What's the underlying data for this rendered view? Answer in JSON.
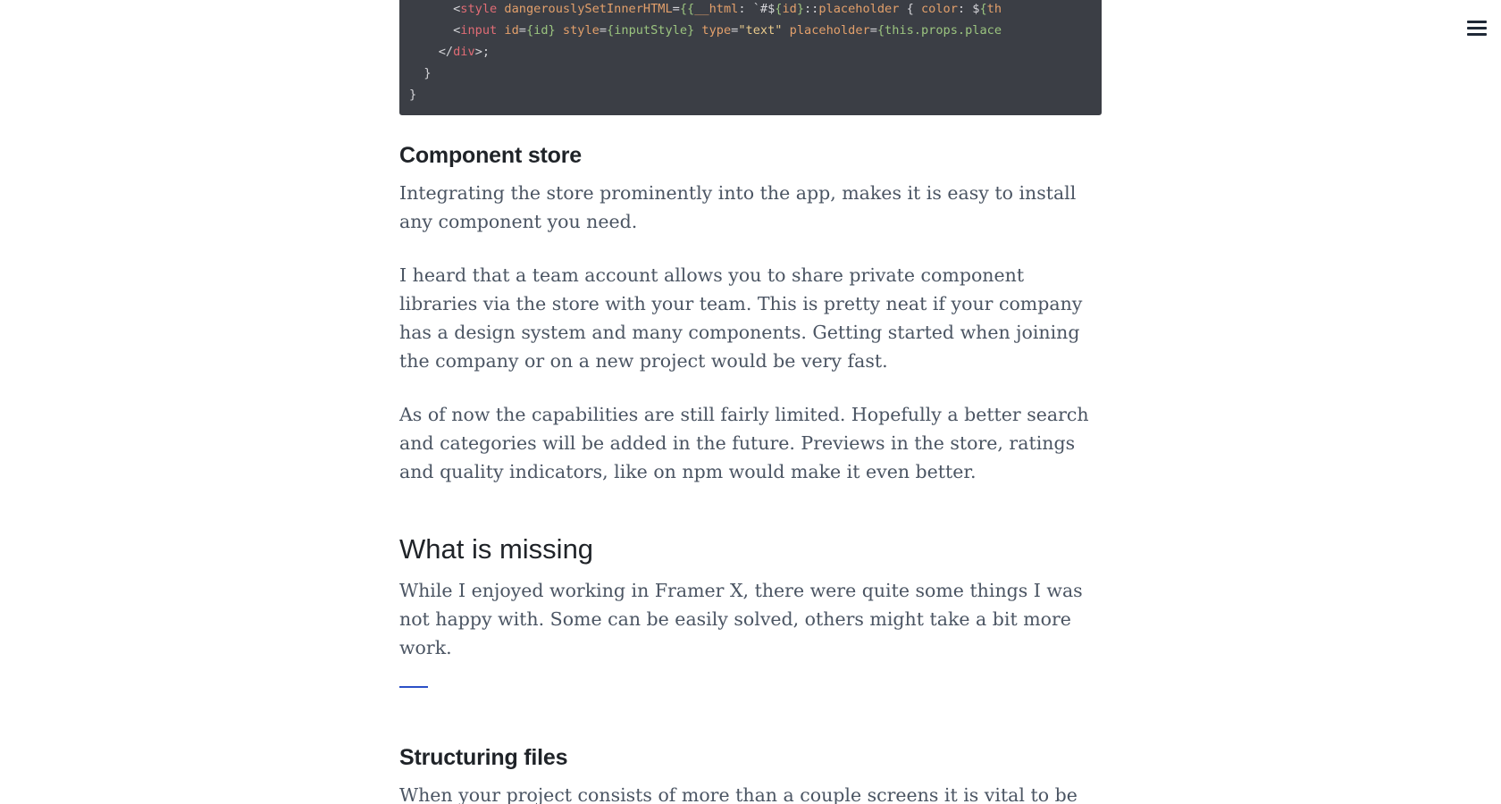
{
  "header": {
    "menu_icon": "hamburger-menu-icon"
  },
  "code": {
    "lines": [
      "      <style dangerouslySetInnerHTML={{__html: `#${id}::placeholder { color: ${th",
      "      <input id={id} style={inputStyle} type=\"text\" placeholder={this.props.place",
      "    </div>;",
      "  }",
      "}"
    ]
  },
  "sections": {
    "component_store": {
      "title": "Component store",
      "paragraphs": [
        "Integrating the store prominently into the app, makes it is easy to install any component you need.",
        "I heard that a team account allows you to share private component libraries via the store with your team. This is pretty neat if your company has a design system and many components. Getting started when joining the company or on a new project would be very fast.",
        "As of now the capabilities are still fairly limited. Hopefully a better search and categories will be added in the future. Previews in the store, ratings and quality indicators, like on npm would make it even better."
      ]
    },
    "what_is_missing": {
      "title": "What is missing",
      "paragraph": "While I enjoyed working in Framer X, there were quite some things I was not happy with. Some can be easily solved, others might take a bit more work."
    },
    "structuring_files": {
      "title": "Structuring files",
      "paragraph": "When your project consists of more than a couple screens it is vital to be able to"
    }
  },
  "colors": {
    "accent": "#2b50c7",
    "code_background": "#3b3e45"
  }
}
